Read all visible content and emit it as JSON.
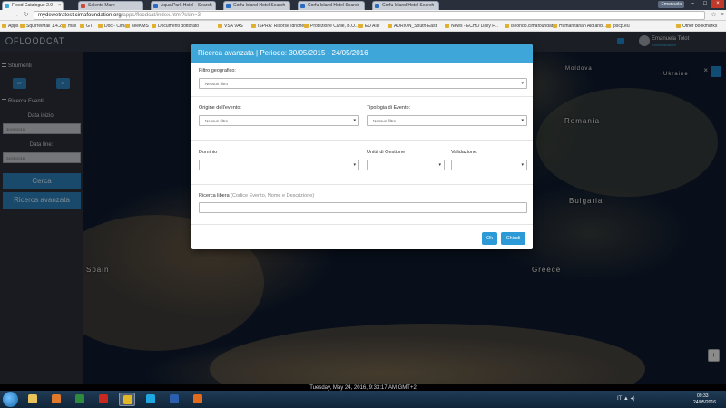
{
  "browser": {
    "tabs": [
      {
        "label": "Flood Catalogue 2.0",
        "favicon_color": "#3fa6d9",
        "active": true
      },
      {
        "label": "Salento Mare",
        "favicon_color": "#d04a3a",
        "active": false
      },
      {
        "label": "Aqua Park Hotel - Search",
        "favicon_color": "#2a6bbf",
        "active": false
      },
      {
        "label": "Corfu Island Hotel Search",
        "favicon_color": "#2a6bbf",
        "active": false
      },
      {
        "label": "Corfu Island Hotel Search",
        "favicon_color": "#2a6bbf",
        "active": false
      },
      {
        "label": "Corfu Island Hotel Search",
        "favicon_color": "#2a6bbf",
        "active": false
      }
    ],
    "profile": "Emanuela",
    "url_host": "mydewetratest.cimafoundation.org",
    "url_path": "/apps/floodcat/index.html?skin=3",
    "bookmarks": [
      "Apps",
      "SquirrelMail 1.4.22",
      "mail",
      "GT",
      "Doc - Cima",
      "seeKMS",
      "Documenti dottorato",
      "VSA VAS",
      "ISPRA: Risorse Idriche",
      "Protezione Civile, B.O...",
      "EU AID",
      "ADRION_South-East",
      "News - ECHO Daily F...",
      "iseondb.cimafoundat...",
      "Humanitarian Aid and...",
      "ipscp.eu",
      "Other bookmarks"
    ]
  },
  "app": {
    "user": {
      "name": "Emanuela Tolot",
      "role": "Amministratore"
    },
    "sidebar": {
      "strumenti_label": "Strumenti",
      "tool_buttons": [
        "GF",
        "EI"
      ],
      "ricerca_label": "Ricerca Eventi",
      "data_inizio_label": "Data inizio:",
      "data_inizio_value": "30/05/2015",
      "data_fine_label": "Data fine:",
      "data_fine_value": "24/05/2016",
      "cerca_label": "Cerca",
      "ricerca_avanzata_label": "Ricerca avanzata"
    },
    "map_labels": {
      "romania": "Romania",
      "bulgaria": "Bulgaria",
      "spain": "Spain",
      "greece": "Greece",
      "ukraine": "Ukraine",
      "moldova": "Moldova"
    }
  },
  "modal": {
    "title": "Ricerca avanzata | Periodo: 30/05/2015 - 24/05/2016",
    "filtro_geografico": {
      "label": "Filtro geografico:",
      "value": "Nessun filtro"
    },
    "origine_evento": {
      "label": "Origine dell'evento:",
      "value": "Nessun filtro"
    },
    "tipologia_evento": {
      "label": "Tipologia di Evento:",
      "value": "Nessun filtro"
    },
    "dominio": {
      "label": "Dominio",
      "value": ""
    },
    "unita_gestione": {
      "label": "Unità di Gestione",
      "value": ""
    },
    "validazione": {
      "label": "Validazione:",
      "value": ""
    },
    "ricerca_libera": {
      "label": "Ricerca libera",
      "hint": "(Codice Evento, Nome e Descrizione)",
      "value": ""
    },
    "ok_label": "Ok",
    "chiudi_label": "Chiudi"
  },
  "status_bar": "Tuesday, May 24, 2016, 9:33:17 AM GMT+2",
  "taskbar": {
    "apps": [
      {
        "name": "explorer",
        "color": "#e8c25a"
      },
      {
        "name": "media-player",
        "color": "#e07a2a"
      },
      {
        "name": "excel",
        "color": "#2e8b3e"
      },
      {
        "name": "acrobat",
        "color": "#c8281e"
      },
      {
        "name": "chrome",
        "color": "#e2b72a"
      },
      {
        "name": "skype",
        "color": "#1ea7e1"
      },
      {
        "name": "word",
        "color": "#2b5fad"
      },
      {
        "name": "firefox",
        "color": "#e06a1e"
      }
    ],
    "lang": "IT",
    "time": "09:33",
    "date": "24/05/2016"
  }
}
